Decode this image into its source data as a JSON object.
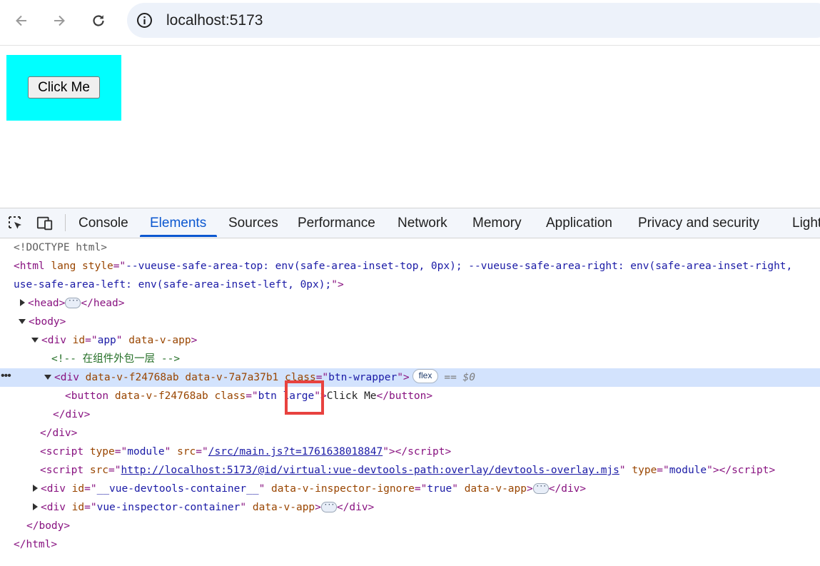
{
  "browser": {
    "back_icon": "arrow-left-icon",
    "forward_icon": "arrow-right-icon",
    "reload_icon": "reload-icon",
    "site_info_icon": "info-icon",
    "url": "localhost:5173"
  },
  "page": {
    "wrapper_color": "#00ffff",
    "button_label": "Click Me"
  },
  "devtools": {
    "tabs": [
      {
        "label": "Console"
      },
      {
        "label": "Elements",
        "active": true
      },
      {
        "label": "Sources"
      },
      {
        "label": "Performance"
      },
      {
        "label": "Network"
      },
      {
        "label": "Memory"
      },
      {
        "label": "Application"
      },
      {
        "label": "Privacy and security"
      },
      {
        "label": "Light"
      }
    ],
    "accent_color": "#0b57d0",
    "dom": {
      "doctype": "<!DOCTYPE html>",
      "html_open_style": "--vueuse-safe-area-top: env(safe-area-inset-top, 0px); --vueuse-safe-area-right: env(safe-area-inset-right,",
      "html_style_cont": "use-safe-area-left: env(safe-area-inset-left, 0px);",
      "comment": "<!-- 在组件外包一层 -->",
      "wrapper_attr1": "data-v-f24768ab",
      "wrapper_attr2": "data-v-7a7a37b1",
      "wrapper_class": "btn-wrapper",
      "flex_badge": "flex",
      "selected_marker": "== $0",
      "button_attr": "data-v-f24768ab",
      "button_class_1": "btn ",
      "button_class_2": "large",
      "button_text": "Click Me",
      "script1_type": "module",
      "script1_src": "/src/main.js?t=1761638018847",
      "script2_src": "http://localhost:5173/@id/virtual:vue-devtools-path:overlay/devtools-overlay.mjs",
      "script2_type": "module",
      "devtools_container_id": "__vue-devtools-container__",
      "inspector_ignore_value": "true",
      "inspector_container_id": "vue-inspector-container"
    }
  }
}
